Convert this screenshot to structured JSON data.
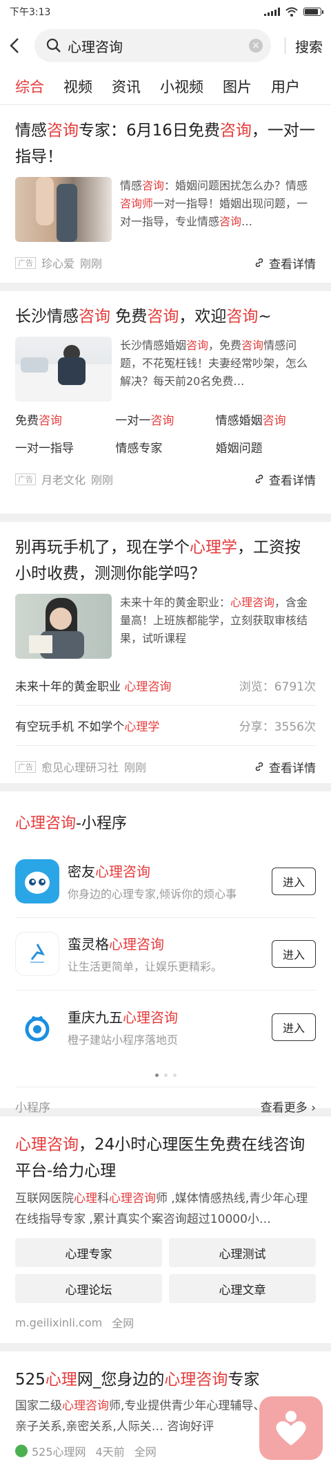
{
  "status": {
    "time": "下午3:13"
  },
  "search": {
    "query": "心理咨询",
    "button": "搜索"
  },
  "tabs": [
    "综合",
    "视频",
    "资讯",
    "小视频",
    "图片",
    "用户"
  ],
  "ad1": {
    "title": [
      {
        "t": "情感"
      },
      {
        "t": "咨询",
        "h": true
      },
      {
        "t": "专家：6月16日免费"
      },
      {
        "t": "咨询",
        "h": true
      },
      {
        "t": "，一对一指导！"
      }
    ],
    "desc": [
      {
        "t": "情感"
      },
      {
        "t": "咨询",
        "h": true
      },
      {
        "t": "：婚姻问题困扰怎么办？情感"
      },
      {
        "t": "咨询师",
        "h": true
      },
      {
        "t": "一对一指导！婚姻出现问题，一对一指导，专业情感"
      },
      {
        "t": "咨询",
        "h": true
      },
      {
        "t": "…"
      }
    ],
    "ad_label": "广告",
    "source": "珍心爱",
    "time": "刚刚",
    "detail": "查看详情"
  },
  "ad2": {
    "title": [
      {
        "t": "长沙情感"
      },
      {
        "t": "咨询",
        "h": true
      },
      {
        "t": " 免费"
      },
      {
        "t": "咨询",
        "h": true
      },
      {
        "t": "，欢迎"
      },
      {
        "t": "咨询",
        "h": true
      },
      {
        "t": "~"
      }
    ],
    "desc": [
      {
        "t": "长沙情感婚姻"
      },
      {
        "t": "咨询",
        "h": true
      },
      {
        "t": "，免费"
      },
      {
        "t": "咨询",
        "h": true
      },
      {
        "t": "情感问题，不花冤枉钱！夫妻经常吵架，怎么解决？每天前20名免费…"
      }
    ],
    "keywords": [
      [
        {
          "t": "免费"
        },
        {
          "t": "咨询",
          "h": true
        }
      ],
      [
        {
          "t": "一对一"
        },
        {
          "t": "咨询",
          "h": true
        }
      ],
      [
        {
          "t": "情感婚姻"
        },
        {
          "t": "咨询",
          "h": true
        }
      ],
      [
        {
          "t": "一对一指导"
        }
      ],
      [
        {
          "t": "情感专家"
        }
      ],
      [
        {
          "t": "婚姻问题"
        }
      ]
    ],
    "ad_label": "广告",
    "source": "月老文化",
    "time": "刚刚",
    "detail": "查看详情"
  },
  "ad3": {
    "title": [
      {
        "t": "别再玩手机了，现在学个"
      },
      {
        "t": "心理学",
        "h": true
      },
      {
        "t": "，工资按小时收费，测测你能学吗？"
      }
    ],
    "desc": [
      {
        "t": "未来十年的黄金职业："
      },
      {
        "t": "心理咨询",
        "h": true
      },
      {
        "t": "，含金量高！上班族都能学，立刻获取审核结果，试听课程"
      }
    ],
    "stats": [
      {
        "label": [
          {
            "t": "未来十年的黄金职业 "
          },
          {
            "t": "心理咨询",
            "h": true
          }
        ],
        "value": "浏览：6791次"
      },
      {
        "label": [
          {
            "t": "有空玩手机 不如学个"
          },
          {
            "t": "心理学",
            "h": true
          }
        ],
        "value": "分享：3556次"
      }
    ],
    "ad_label": "广告",
    "source": "愈见心理研习社",
    "time": "刚刚",
    "detail": "查看详情"
  },
  "miniprograms": {
    "title": [
      {
        "t": "心理咨询",
        "h": true
      },
      {
        "t": "-小程序"
      }
    ],
    "items": [
      {
        "name": [
          {
            "t": "密友"
          },
          {
            "t": "心理咨询",
            "h": true
          }
        ],
        "desc": "你身边的心理专家,倾诉你的烦心事",
        "button": "进入"
      },
      {
        "name": [
          {
            "t": "蛮灵格"
          },
          {
            "t": "心理咨询",
            "h": true
          }
        ],
        "desc": "让生活更简单，让娱乐更精彩。",
        "button": "进入"
      },
      {
        "name": [
          {
            "t": "重庆九五"
          },
          {
            "t": "心理咨询",
            "h": true
          }
        ],
        "desc": "橙子建站小程序落地页",
        "button": "进入"
      }
    ],
    "footer_label": "小程序",
    "more": "查看更多 ›"
  },
  "result4": {
    "title": [
      {
        "t": "心理咨询",
        "h": true
      },
      {
        "t": "，24小时心理医生免费在线咨询平台-给力心理"
      }
    ],
    "desc": [
      {
        "t": "互联网医院"
      },
      {
        "t": "心理",
        "h": true
      },
      {
        "t": "科"
      },
      {
        "t": "心理咨询",
        "h": true
      },
      {
        "t": "师 ,媒体情感热线,青少年心理在线指导专家 ,累计真实个案咨询超过10000小…"
      }
    ],
    "links": [
      "心理专家",
      "心理测试",
      "心理论坛",
      "心理文章"
    ],
    "site": "m.geilixinli.com",
    "scope": "全网"
  },
  "result5": {
    "title": [
      {
        "t": "525"
      },
      {
        "t": "心理",
        "h": true
      },
      {
        "t": "网_您身边的"
      },
      {
        "t": "心理咨询",
        "h": true
      },
      {
        "t": "专家"
      }
    ],
    "desc": [
      {
        "t": "国家二级"
      },
      {
        "t": "心理咨询",
        "h": true
      },
      {
        "t": "师,专业提供青少年心理辅导、婚姻成长,亲子关系,亲密关系,人际关… 咨询好评"
      }
    ],
    "site": "525心理网",
    "time": "4天前",
    "scope": "全网"
  }
}
